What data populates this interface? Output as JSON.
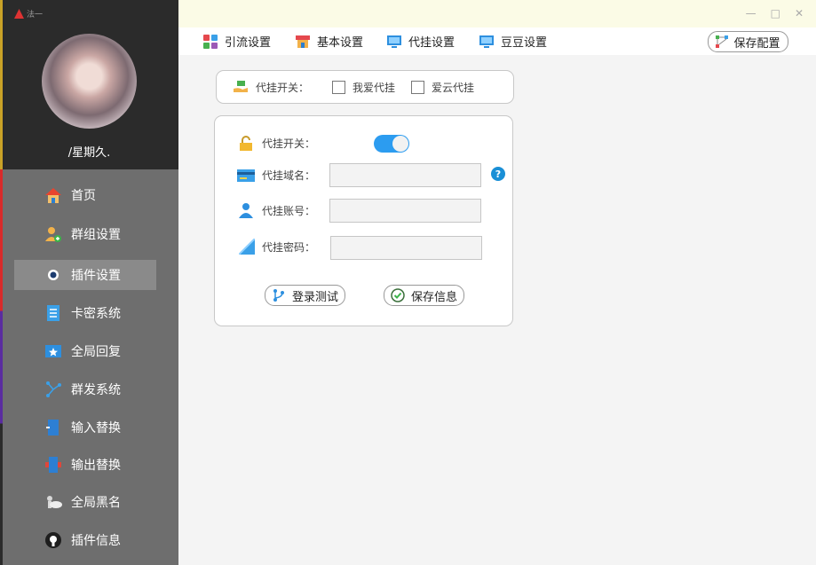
{
  "app": {
    "logo_text": "法一"
  },
  "window_controls": {
    "minimize": "—",
    "maximize": "□",
    "close": "✕"
  },
  "user": {
    "name": "/星期久."
  },
  "sidebar": {
    "items": [
      {
        "label": "首页",
        "icon": "home-icon"
      },
      {
        "label": "群组设置",
        "icon": "group-user-icon"
      },
      {
        "label": "插件设置",
        "icon": "plugin-icon",
        "active": true
      },
      {
        "label": "卡密系统",
        "icon": "card-book-icon"
      },
      {
        "label": "全局回复",
        "icon": "star-monitor-icon"
      },
      {
        "label": "群发系统",
        "icon": "broadcast-icon"
      },
      {
        "label": "输入替换",
        "icon": "input-door-icon"
      },
      {
        "label": "输出替换",
        "icon": "output-door-icon"
      },
      {
        "label": "全局黑名",
        "icon": "cloud-user-icon"
      },
      {
        "label": "插件信息",
        "icon": "github-icon"
      }
    ]
  },
  "toolbar": {
    "tabs": [
      {
        "label": "引流设置",
        "icon": "grid-apps-icon"
      },
      {
        "label": "基本设置",
        "icon": "store-icon"
      },
      {
        "label": "代挂设置",
        "icon": "monitor-icon"
      },
      {
        "label": "豆豆设置",
        "icon": "monitor-icon"
      }
    ],
    "save_label": "保存配置"
  },
  "switch_card": {
    "label": "代挂开关：",
    "options": [
      {
        "label": "我爱代挂",
        "checked": false
      },
      {
        "label": "爱云代挂",
        "checked": false
      }
    ]
  },
  "form": {
    "switch_label": "代挂开关：",
    "switch_on": true,
    "domain_label": "代挂域名：",
    "domain_value": "",
    "account_label": "代挂账号：",
    "account_value": "",
    "password_label": "代挂密码：",
    "password_value": "",
    "help": "?",
    "login_test_label": "登录测试",
    "save_info_label": "保存信息"
  },
  "colors": {
    "toggle": "#2c9cf0",
    "sidebar": "#6e6e6e",
    "titlebar": "#fbfbe6"
  }
}
